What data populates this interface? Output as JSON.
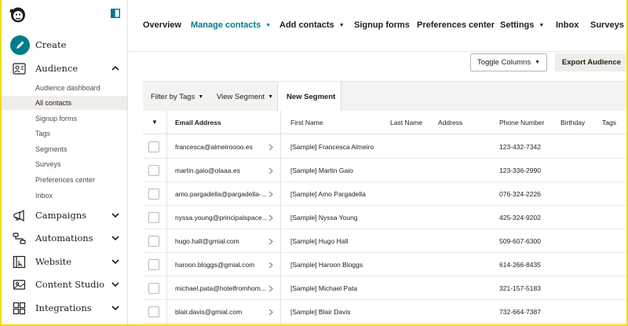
{
  "sidebar": {
    "create_label": "Create",
    "audience_label": "Audience",
    "audience_items": [
      {
        "label": "Audience dashboard"
      },
      {
        "label": "All contacts"
      },
      {
        "label": "Signup forms"
      },
      {
        "label": "Tags"
      },
      {
        "label": "Segments"
      },
      {
        "label": "Surveys"
      },
      {
        "label": "Preferences center"
      },
      {
        "label": "Inbox"
      }
    ],
    "active_item": "All contacts",
    "sections": [
      {
        "label": "Campaigns",
        "icon": "megaphone-icon"
      },
      {
        "label": "Automations",
        "icon": "automation-icon"
      },
      {
        "label": "Website",
        "icon": "website-icon"
      },
      {
        "label": "Content Studio",
        "icon": "content-studio-icon"
      },
      {
        "label": "Integrations",
        "icon": "integrations-icon"
      }
    ]
  },
  "topnav": {
    "tabs": [
      {
        "label": "Overview"
      },
      {
        "label": "Manage contacts"
      },
      {
        "label": "Add contacts"
      },
      {
        "label": "Signup forms"
      },
      {
        "label": "Preferences center"
      },
      {
        "label": "Settings"
      },
      {
        "label": "Inbox"
      },
      {
        "label": "Surveys"
      }
    ],
    "active_tab": "Manage contacts"
  },
  "actions": {
    "toggle_columns": "Toggle Columns",
    "export_audience": "Export Audience"
  },
  "filters": {
    "filter_by_tags": "Filter by Tags",
    "view_segment": "View Segment",
    "new_segment": "New Segment"
  },
  "table": {
    "columns": [
      "Email Address",
      "First Name",
      "Last Name",
      "Address",
      "Phone Number",
      "Birthday",
      "Tags"
    ],
    "rows": [
      {
        "email": "francesca@almeiroooo.es",
        "first_name": "[Sample] Francesca Almeiro",
        "phone": "123-432-7342"
      },
      {
        "email": "martin.gaio@olaaa.es",
        "first_name": "[Sample] Martin Gaio",
        "phone": "123-336-2990"
      },
      {
        "email": "amo.pargadella@pargadella-...",
        "first_name": "[Sample] Amo Pargadella",
        "phone": "076-324-2226"
      },
      {
        "email": "nyssa.young@principalspace...",
        "first_name": "[Sample] Nyssa Young",
        "phone": "425-324-9202"
      },
      {
        "email": "hugo.hall@gmial.com",
        "first_name": "[Sample] Hugo Hall",
        "phone": "509-607-6300"
      },
      {
        "email": "haroon.bloggs@gmial.com",
        "first_name": "[Sample] Haroon Bloggs",
        "phone": "614-266-8435"
      },
      {
        "email": "michael.pata@hotelfromhom...",
        "first_name": "[Sample] Michael Pata",
        "phone": "321-157-5183"
      },
      {
        "email": "blair.davis@gmial.com",
        "first_name": "[Sample] Blair Davis",
        "phone": "732-664-7387"
      }
    ]
  },
  "colors": {
    "accent": "#007c89",
    "frame": "#f5d90a"
  }
}
